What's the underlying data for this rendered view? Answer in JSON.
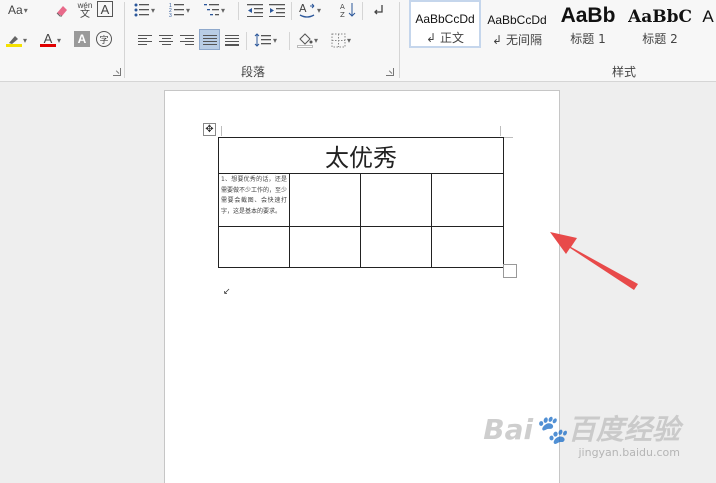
{
  "ribbon": {
    "font": {
      "change_case_label": "Aa",
      "clear_format_label": "",
      "phonetic_top": "wén",
      "phonetic_bottom": "文",
      "char_border_label": "A",
      "font_color_label": "A",
      "char_shading_label": "A",
      "enclose_char_label": "字"
    },
    "paragraph": {
      "group_label": "段落"
    },
    "styles": {
      "group_label": "样式",
      "items": [
        {
          "sample": "AaBbCcDd",
          "name": "正文",
          "prefix": "↲"
        },
        {
          "sample": "AaBbCcDd",
          "name": "无间隔",
          "prefix": "↲"
        },
        {
          "sample": "AaBb",
          "name": "标题 1",
          "prefix": ""
        },
        {
          "sample": "AaBbC",
          "name": "标题 2",
          "prefix": ""
        },
        {
          "sample": "A",
          "name": "",
          "prefix": ""
        }
      ]
    },
    "colors": {
      "highlight": "#f5e100",
      "font_color": "#e00000",
      "accent_selected": "#c5d6ec"
    }
  },
  "document": {
    "table": {
      "title": "太优秀",
      "note": "1、想要优秀的话，还是需要做不少工作的，至少需要会截图、会快速打字，这是基本的要求。"
    }
  },
  "annotation": {
    "arrow_color": "#e84a4a"
  },
  "watermark": {
    "logo": "Bai🐾百度经验",
    "url": "jingyan.baidu.com"
  }
}
